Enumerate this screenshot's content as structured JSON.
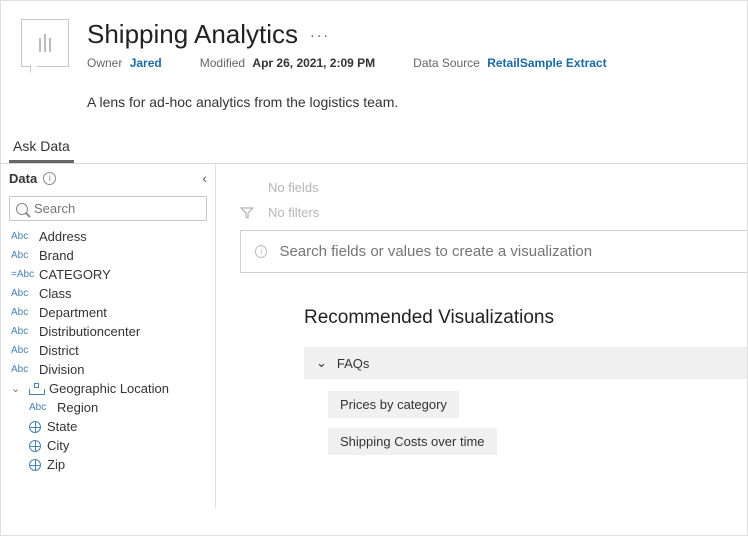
{
  "header": {
    "title": "Shipping Analytics",
    "more": "···",
    "owner_label": "Owner",
    "owner": "Jared",
    "modified_label": "Modified",
    "modified": "Apr 26, 2021, 2:09 PM",
    "datasource_label": "Data Source",
    "datasource": "RetailSample Extract",
    "description": "A lens for ad-hoc analytics from the logistics team."
  },
  "tab": {
    "label": "Ask Data"
  },
  "sidebar": {
    "title": "Data",
    "collapse": "‹",
    "search_placeholder": "Search",
    "fields": [
      {
        "type": "Abc",
        "label": "Address"
      },
      {
        "type": "Abc",
        "label": "Brand"
      },
      {
        "type": "=Abc",
        "label": "CATEGORY"
      },
      {
        "type": "Abc",
        "label": "Class"
      },
      {
        "type": "Abc",
        "label": "Department"
      },
      {
        "type": "Abc",
        "label": "Distributioncenter"
      },
      {
        "type": "Abc",
        "label": "District"
      },
      {
        "type": "Abc",
        "label": "Division"
      }
    ],
    "hierarchy": {
      "caret": "⌄",
      "label": "Geographic Location",
      "children": [
        {
          "type": "Abc",
          "label": "Region"
        },
        {
          "type": "geo",
          "label": "State"
        },
        {
          "type": "geo",
          "label": "City"
        },
        {
          "type": "geo",
          "label": "Zip"
        }
      ]
    }
  },
  "main": {
    "no_fields": "No fields",
    "no_filters": "No filters",
    "search_placeholder": "Search fields or values to create a visualization",
    "rec_title": "Recommended Visualizations",
    "faq": {
      "caret": "⌄",
      "label": "FAQs",
      "items": [
        "Prices by category",
        "Shipping Costs over time"
      ]
    }
  }
}
